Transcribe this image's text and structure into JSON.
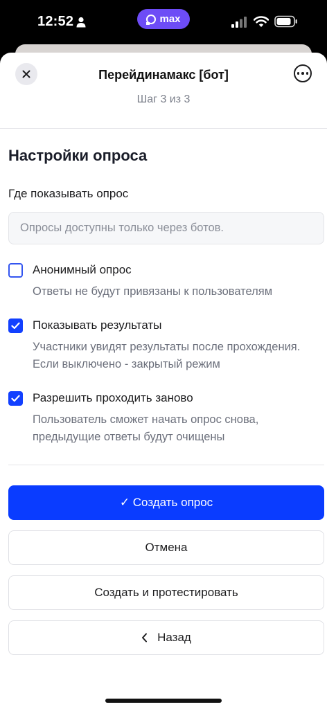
{
  "status_bar": {
    "time": "12:52",
    "badge_text": "max"
  },
  "header": {
    "title": "Перейдинамакс [бот]",
    "step": "Шаг 3 из 3"
  },
  "form": {
    "section_title": "Настройки опроса",
    "location_label": "Где показывать опрос",
    "location_value": "Опросы доступны только через ботов.",
    "options": [
      {
        "label": "Анонимный опрос",
        "description": "Ответы не будут привязаны к пользователям",
        "checked": false
      },
      {
        "label": "Показывать результаты",
        "description": "Участники увидят результаты после прохождения. Если выключено - закрытый режим",
        "checked": true
      },
      {
        "label": "Разрешить проходить заново",
        "description": "Пользователь сможет начать опрос снова, предыдущие ответы будут очищены",
        "checked": true
      }
    ]
  },
  "actions": {
    "create": "✓ Создать опрос",
    "cancel": "Отмена",
    "create_and_test": "Создать и протестировать",
    "back": "Назад"
  },
  "colors": {
    "primary": "#0a3cff",
    "checkbox": "#1240ff",
    "badge": "#6d4cf6"
  }
}
